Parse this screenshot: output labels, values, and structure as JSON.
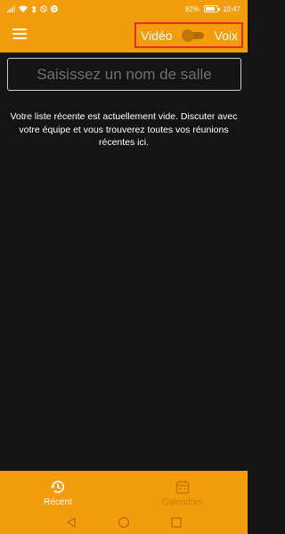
{
  "status_bar": {
    "battery_percent": "82%",
    "time": "10:47",
    "battery_level": 0.82,
    "icons": [
      "signal-icon",
      "wifi-icon",
      "bluetooth-icon",
      "do-not-disturb-icon",
      "spotify-icon",
      "battery-icon"
    ]
  },
  "app_bar": {
    "menu_icon": "hamburger-menu-icon",
    "video_label": "Vidéo",
    "voice_label": "Voix",
    "toggle_state": "off"
  },
  "room_input": {
    "placeholder": "Saisissez un nom de salle",
    "value": ""
  },
  "empty_message": "Votre liste récente est actuellement vide. Discuter avec votre équipe et vous trouverez toutes vos réunions récentes ici.",
  "bottom_nav": {
    "tabs": [
      {
        "label": "Récent",
        "icon": "history-icon",
        "active": true
      },
      {
        "label": "Calendrier",
        "icon": "calendar-icon",
        "active": false
      }
    ]
  },
  "system_nav": [
    "back-icon",
    "home-icon",
    "recents-icon"
  ],
  "colors": {
    "accent": "#f39c0c",
    "background": "#141414",
    "highlight_border": "#e2301f",
    "inactive_tab": "#c97d08"
  }
}
